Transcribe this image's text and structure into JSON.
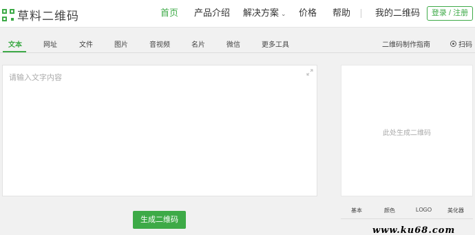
{
  "header": {
    "logo_text": "草料二维码",
    "nav": {
      "home": "首页",
      "products": "产品介绍",
      "solutions": "解决方案",
      "price": "价格",
      "help": "帮助",
      "my_codes": "我的二维码"
    },
    "login_label": "登录 / 注册"
  },
  "tabs": {
    "items": [
      "文本",
      "网址",
      "文件",
      "图片",
      "音视频",
      "名片",
      "微信",
      "更多工具"
    ],
    "active": "文本",
    "guide": "二维码制作指南",
    "scan": "扫码"
  },
  "editor": {
    "placeholder": "请输入文字内容",
    "value": ""
  },
  "generate_label": "生成二维码",
  "preview": {
    "placeholder": "此处生成二维码",
    "style_tabs": [
      "基本",
      "颜色",
      "LOGO",
      "美化器"
    ]
  },
  "watermark": "www.ku68.com",
  "colors": {
    "accent": "#3daa47"
  }
}
